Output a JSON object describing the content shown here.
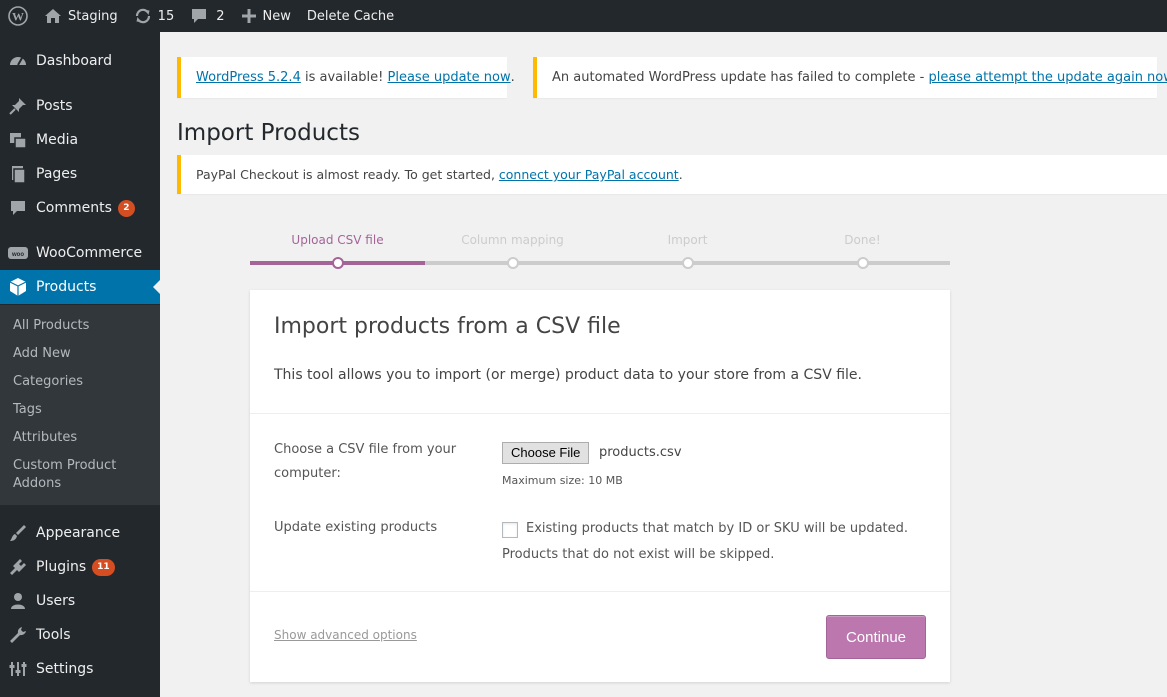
{
  "admin_bar": {
    "site_name": "Staging",
    "updates_count": "15",
    "comments_count": "2",
    "new_label": "New",
    "delete_cache_label": "Delete Cache"
  },
  "sidebar": {
    "dashboard": "Dashboard",
    "posts": "Posts",
    "media": "Media",
    "pages": "Pages",
    "comments": "Comments",
    "comments_badge": "2",
    "woocommerce": "WooCommerce",
    "woo_icon_text": "woo",
    "products": "Products",
    "submenu": [
      "All Products",
      "Add New",
      "Categories",
      "Tags",
      "Attributes",
      "Custom Product Addons"
    ],
    "appearance": "Appearance",
    "plugins": "Plugins",
    "plugins_badge": "11",
    "users": "Users",
    "tools": "Tools",
    "settings": "Settings"
  },
  "notices": {
    "update_link": "WordPress 5.2.4",
    "update_text": " is available! ",
    "update_now_link": "Please update now",
    "update_end": ".",
    "failed_text": "An automated WordPress update has failed to complete - ",
    "failed_link": "please attempt the update again now",
    "failed_end": ".",
    "paypal_text": "PayPal Checkout is almost ready. To get started, ",
    "paypal_link": "connect your PayPal account",
    "paypal_end": "."
  },
  "page_title": "Import Products",
  "steps": [
    "Upload CSV file",
    "Column mapping",
    "Import",
    "Done!"
  ],
  "active_step": 0,
  "card": {
    "title": "Import products from a CSV file",
    "description": "This tool allows you to import (or merge) product data to your store from a CSV file.",
    "file_label": "Choose a CSV file from your computer:",
    "file_button": "Choose File",
    "file_name": "products.csv",
    "max_size": "Maximum size: 10 MB",
    "update_label": "Update existing products",
    "update_checked": false,
    "update_desc": "Existing products that match by ID or SKU will be updated.",
    "skip_desc": "Products that do not exist will be skipped.",
    "advanced_link": "Show advanced options",
    "continue_button": "Continue"
  },
  "colors": {
    "admin_bg": "#23282d",
    "accent": "#0073aa",
    "woo_purple": "#a46497",
    "continue_bg": "#bb77ae",
    "notice_border": "#ffb900",
    "badge": "#d54e21"
  },
  "icons": [
    "wordpress-logo-icon",
    "home-icon",
    "updates-icon",
    "comment-icon",
    "plus-icon",
    "dashboard-icon",
    "pushpin-icon",
    "media-icon",
    "pages-icon",
    "woocommerce-icon",
    "products-box-icon",
    "appearance-brush-icon",
    "plugins-icon",
    "users-icon",
    "tools-wrench-icon",
    "settings-sliders-icon"
  ]
}
